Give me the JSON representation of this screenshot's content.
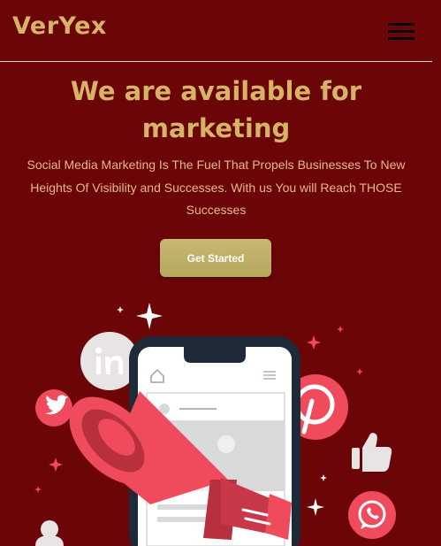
{
  "header": {
    "logo": "VerYex",
    "menu_icon": "hamburger-menu-icon"
  },
  "hero": {
    "title_line1": "We are available for",
    "title_line2": "marketing",
    "subtitle_line1": "Social Media Marketing Is The Fuel That Propels Businesses To New",
    "subtitle_line2": "Heights Of Visibility and Successes. With us You will Reach THOSE",
    "subtitle_line3": "Successes",
    "cta_label": "Get Started"
  },
  "illustration": {
    "icons": [
      "linkedin-icon",
      "twitter-icon",
      "pinterest-icon",
      "thumbs-up-icon",
      "whatsapp-icon",
      "user-icon",
      "home-icon",
      "megaphone-icon",
      "sparkle-icon"
    ]
  },
  "colors": {
    "background": "#6b0507",
    "gold": "#d6b466",
    "subtitle": "#e5b987",
    "button": "#c2b36b",
    "accent_red": "#ef4b5c"
  }
}
